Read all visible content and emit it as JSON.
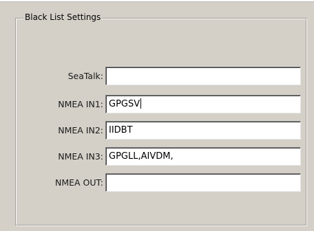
{
  "groupbox": {
    "title": "Black List Settings"
  },
  "fields": [
    {
      "label": "SeaTalk:",
      "value": ""
    },
    {
      "label": "NMEA IN1:",
      "value": "GPGSV"
    },
    {
      "label": "NMEA IN2:",
      "value": "IIDBT"
    },
    {
      "label": "NMEA IN3:",
      "value": "GPGLL,AIVDM,"
    },
    {
      "label": "NMEA OUT:",
      "value": ""
    }
  ],
  "colors": {
    "background": "#d4d0c8",
    "field_background": "#ffffff"
  }
}
